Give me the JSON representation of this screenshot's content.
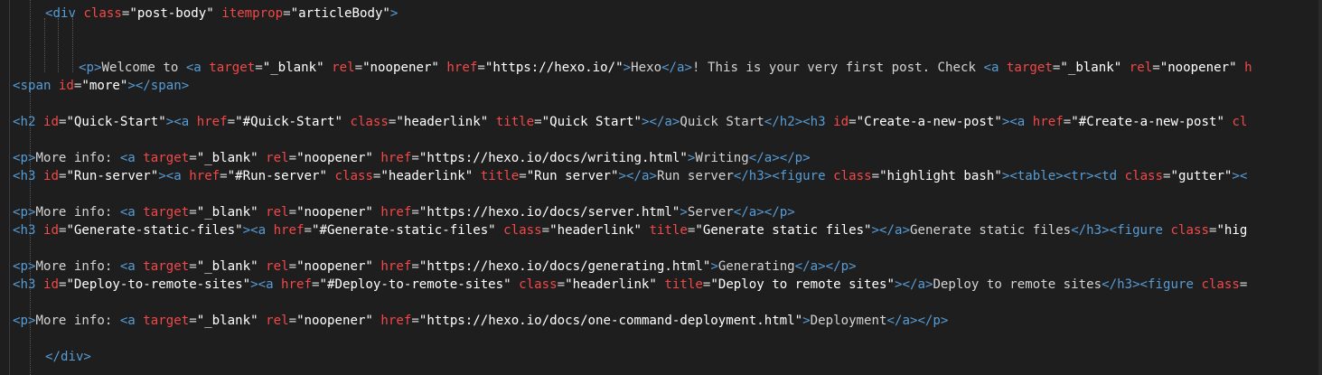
{
  "editor": {
    "lines": [
      [
        [
          "t-tag",
          "<div "
        ],
        [
          "t-attr",
          "class"
        ],
        [
          "t-eq",
          "="
        ],
        [
          "t-val",
          "\"post-body\""
        ],
        [
          "t-txt",
          " "
        ],
        [
          "t-attr",
          "itemprop"
        ],
        [
          "t-eq",
          "="
        ],
        [
          "t-val",
          "\"articleBody\""
        ],
        [
          "t-tag",
          ">"
        ]
      ],
      [],
      [],
      [
        [
          "t-tag",
          "<p>"
        ],
        [
          "t-txt",
          "Welcome to "
        ],
        [
          "t-tag",
          "<a "
        ],
        [
          "t-attr",
          "target"
        ],
        [
          "t-eq",
          "="
        ],
        [
          "t-val",
          "\"_blank\""
        ],
        [
          "t-txt",
          " "
        ],
        [
          "t-attr",
          "rel"
        ],
        [
          "t-eq",
          "="
        ],
        [
          "t-val",
          "\"noopener\""
        ],
        [
          "t-txt",
          " "
        ],
        [
          "t-attr",
          "href"
        ],
        [
          "t-eq",
          "="
        ],
        [
          "t-val",
          "\"https://hexo.io/\""
        ],
        [
          "t-tag",
          ">"
        ],
        [
          "t-txt",
          "Hexo"
        ],
        [
          "t-tag",
          "</a>"
        ],
        [
          "t-txt",
          "! This is your very first post. Check "
        ],
        [
          "t-tag",
          "<a "
        ],
        [
          "t-attr",
          "target"
        ],
        [
          "t-eq",
          "="
        ],
        [
          "t-val",
          "\"_blank\""
        ],
        [
          "t-txt",
          " "
        ],
        [
          "t-attr",
          "rel"
        ],
        [
          "t-eq",
          "="
        ],
        [
          "t-val",
          "\"noopener\""
        ],
        [
          "t-txt",
          " "
        ],
        [
          "t-attr",
          "h"
        ]
      ],
      [
        [
          "t-tag",
          "<span "
        ],
        [
          "t-attr",
          "id"
        ],
        [
          "t-eq",
          "="
        ],
        [
          "t-val",
          "\"more\""
        ],
        [
          "t-tag",
          "></span>"
        ]
      ],
      [],
      [
        [
          "t-tag",
          "<h2 "
        ],
        [
          "t-attr",
          "id"
        ],
        [
          "t-eq",
          "="
        ],
        [
          "t-val",
          "\"Quick-Start\""
        ],
        [
          "t-tag",
          "><a "
        ],
        [
          "t-attr",
          "href"
        ],
        [
          "t-eq",
          "="
        ],
        [
          "t-val",
          "\"#Quick-Start\""
        ],
        [
          "t-txt",
          " "
        ],
        [
          "t-attr",
          "class"
        ],
        [
          "t-eq",
          "="
        ],
        [
          "t-val",
          "\"headerlink\""
        ],
        [
          "t-txt",
          " "
        ],
        [
          "t-attr",
          "title"
        ],
        [
          "t-eq",
          "="
        ],
        [
          "t-val",
          "\"Quick Start\""
        ],
        [
          "t-tag",
          "></a>"
        ],
        [
          "t-txt",
          "Quick Start"
        ],
        [
          "t-tag",
          "</h2><h3 "
        ],
        [
          "t-attr",
          "id"
        ],
        [
          "t-eq",
          "="
        ],
        [
          "t-val",
          "\"Create-a-new-post\""
        ],
        [
          "t-tag",
          "><a "
        ],
        [
          "t-attr",
          "href"
        ],
        [
          "t-eq",
          "="
        ],
        [
          "t-val",
          "\"#Create-a-new-post\""
        ],
        [
          "t-txt",
          " "
        ],
        [
          "t-attr",
          "cl"
        ]
      ],
      [],
      [
        [
          "t-tag",
          "<p>"
        ],
        [
          "t-txt",
          "More info: "
        ],
        [
          "t-tag",
          "<a "
        ],
        [
          "t-attr",
          "target"
        ],
        [
          "t-eq",
          "="
        ],
        [
          "t-val",
          "\"_blank\""
        ],
        [
          "t-txt",
          " "
        ],
        [
          "t-attr",
          "rel"
        ],
        [
          "t-eq",
          "="
        ],
        [
          "t-val",
          "\"noopener\""
        ],
        [
          "t-txt",
          " "
        ],
        [
          "t-attr",
          "href"
        ],
        [
          "t-eq",
          "="
        ],
        [
          "t-val",
          "\"https://hexo.io/docs/writing.html\""
        ],
        [
          "t-tag",
          ">"
        ],
        [
          "t-txt",
          "Writing"
        ],
        [
          "t-tag",
          "</a></p>"
        ]
      ],
      [
        [
          "t-tag",
          "<h3 "
        ],
        [
          "t-attr",
          "id"
        ],
        [
          "t-eq",
          "="
        ],
        [
          "t-val",
          "\"Run-server\""
        ],
        [
          "t-tag",
          "><a "
        ],
        [
          "t-attr",
          "href"
        ],
        [
          "t-eq",
          "="
        ],
        [
          "t-val",
          "\"#Run-server\""
        ],
        [
          "t-txt",
          " "
        ],
        [
          "t-attr",
          "class"
        ],
        [
          "t-eq",
          "="
        ],
        [
          "t-val",
          "\"headerlink\""
        ],
        [
          "t-txt",
          " "
        ],
        [
          "t-attr",
          "title"
        ],
        [
          "t-eq",
          "="
        ],
        [
          "t-val",
          "\"Run server\""
        ],
        [
          "t-tag",
          "></a>"
        ],
        [
          "t-txt",
          "Run server"
        ],
        [
          "t-tag",
          "</h3><figure "
        ],
        [
          "t-attr",
          "class"
        ],
        [
          "t-eq",
          "="
        ],
        [
          "t-val",
          "\"highlight bash\""
        ],
        [
          "t-tag",
          "><table><tr><td "
        ],
        [
          "t-attr",
          "class"
        ],
        [
          "t-eq",
          "="
        ],
        [
          "t-val",
          "\"gutter\""
        ],
        [
          "t-tag",
          "><"
        ]
      ],
      [],
      [
        [
          "t-tag",
          "<p>"
        ],
        [
          "t-txt",
          "More info: "
        ],
        [
          "t-tag",
          "<a "
        ],
        [
          "t-attr",
          "target"
        ],
        [
          "t-eq",
          "="
        ],
        [
          "t-val",
          "\"_blank\""
        ],
        [
          "t-txt",
          " "
        ],
        [
          "t-attr",
          "rel"
        ],
        [
          "t-eq",
          "="
        ],
        [
          "t-val",
          "\"noopener\""
        ],
        [
          "t-txt",
          " "
        ],
        [
          "t-attr",
          "href"
        ],
        [
          "t-eq",
          "="
        ],
        [
          "t-val",
          "\"https://hexo.io/docs/server.html\""
        ],
        [
          "t-tag",
          ">"
        ],
        [
          "t-txt",
          "Server"
        ],
        [
          "t-tag",
          "</a></p>"
        ]
      ],
      [
        [
          "t-tag",
          "<h3 "
        ],
        [
          "t-attr",
          "id"
        ],
        [
          "t-eq",
          "="
        ],
        [
          "t-val",
          "\"Generate-static-files\""
        ],
        [
          "t-tag",
          "><a "
        ],
        [
          "t-attr",
          "href"
        ],
        [
          "t-eq",
          "="
        ],
        [
          "t-val",
          "\"#Generate-static-files\""
        ],
        [
          "t-txt",
          " "
        ],
        [
          "t-attr",
          "class"
        ],
        [
          "t-eq",
          "="
        ],
        [
          "t-val",
          "\"headerlink\""
        ],
        [
          "t-txt",
          " "
        ],
        [
          "t-attr",
          "title"
        ],
        [
          "t-eq",
          "="
        ],
        [
          "t-val",
          "\"Generate static files\""
        ],
        [
          "t-tag",
          "></a>"
        ],
        [
          "t-txt",
          "Generate static files"
        ],
        [
          "t-tag",
          "</h3><figure "
        ],
        [
          "t-attr",
          "class"
        ],
        [
          "t-eq",
          "="
        ],
        [
          "t-val",
          "\"hig"
        ]
      ],
      [],
      [
        [
          "t-tag",
          "<p>"
        ],
        [
          "t-txt",
          "More info: "
        ],
        [
          "t-tag",
          "<a "
        ],
        [
          "t-attr",
          "target"
        ],
        [
          "t-eq",
          "="
        ],
        [
          "t-val",
          "\"_blank\""
        ],
        [
          "t-txt",
          " "
        ],
        [
          "t-attr",
          "rel"
        ],
        [
          "t-eq",
          "="
        ],
        [
          "t-val",
          "\"noopener\""
        ],
        [
          "t-txt",
          " "
        ],
        [
          "t-attr",
          "href"
        ],
        [
          "t-eq",
          "="
        ],
        [
          "t-val",
          "\"https://hexo.io/docs/generating.html\""
        ],
        [
          "t-tag",
          ">"
        ],
        [
          "t-txt",
          "Generating"
        ],
        [
          "t-tag",
          "</a></p>"
        ]
      ],
      [
        [
          "t-tag",
          "<h3 "
        ],
        [
          "t-attr",
          "id"
        ],
        [
          "t-eq",
          "="
        ],
        [
          "t-val",
          "\"Deploy-to-remote-sites\""
        ],
        [
          "t-tag",
          "><a "
        ],
        [
          "t-attr",
          "href"
        ],
        [
          "t-eq",
          "="
        ],
        [
          "t-val",
          "\"#Deploy-to-remote-sites\""
        ],
        [
          "t-txt",
          " "
        ],
        [
          "t-attr",
          "class"
        ],
        [
          "t-eq",
          "="
        ],
        [
          "t-val",
          "\"headerlink\""
        ],
        [
          "t-txt",
          " "
        ],
        [
          "t-attr",
          "title"
        ],
        [
          "t-eq",
          "="
        ],
        [
          "t-val",
          "\"Deploy to remote sites\""
        ],
        [
          "t-tag",
          "></a>"
        ],
        [
          "t-txt",
          "Deploy to remote sites"
        ],
        [
          "t-tag",
          "</h3><figure "
        ],
        [
          "t-attr",
          "class"
        ],
        [
          "t-eq",
          "="
        ]
      ],
      [],
      [
        [
          "t-tag",
          "<p>"
        ],
        [
          "t-txt",
          "More info: "
        ],
        [
          "t-tag",
          "<a "
        ],
        [
          "t-attr",
          "target"
        ],
        [
          "t-eq",
          "="
        ],
        [
          "t-val",
          "\"_blank\""
        ],
        [
          "t-txt",
          " "
        ],
        [
          "t-attr",
          "rel"
        ],
        [
          "t-eq",
          "="
        ],
        [
          "t-val",
          "\"noopener\""
        ],
        [
          "t-txt",
          " "
        ],
        [
          "t-attr",
          "href"
        ],
        [
          "t-eq",
          "="
        ],
        [
          "t-val",
          "\"https://hexo.io/docs/one-command-deployment.html\""
        ],
        [
          "t-tag",
          ">"
        ],
        [
          "t-txt",
          "Deployment"
        ],
        [
          "t-tag",
          "</a></p>"
        ]
      ],
      [],
      [
        [
          "t-tag",
          "</div>"
        ]
      ]
    ]
  }
}
